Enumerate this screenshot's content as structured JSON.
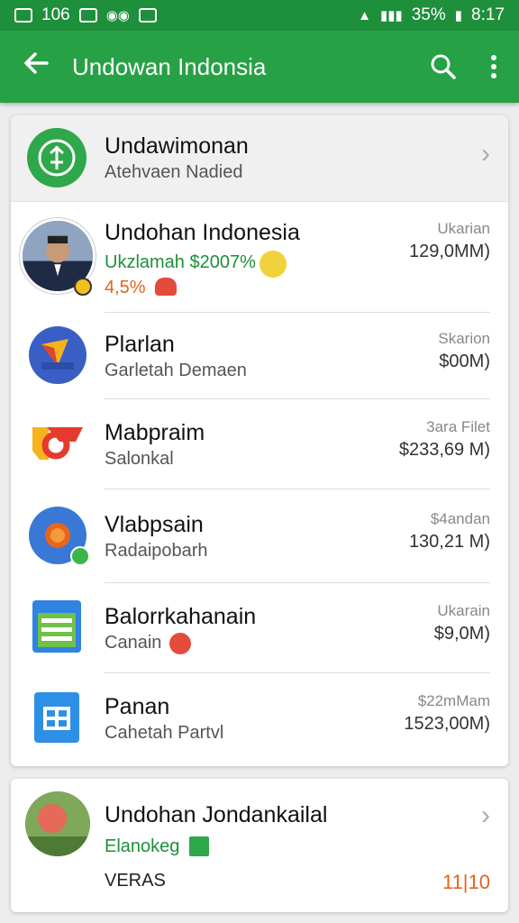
{
  "status_bar": {
    "left_text": "106",
    "battery": "35%",
    "time": "8:17"
  },
  "app_bar": {
    "title": "Undowan Indonsia"
  },
  "header": {
    "title": "Undawimonan",
    "subtitle": "Atehvaen Nadied"
  },
  "list": [
    {
      "name": "Undohan Indonesia",
      "sub": "Ukzlamah $2007%",
      "sub2": "4,5%",
      "right_top": "Ukarian",
      "right_value": "129,0MM)"
    },
    {
      "name": "Plarlan",
      "sub": "Garletah Demaen",
      "right_top": "Skarion",
      "right_value": "$00M)"
    },
    {
      "name": "Mabpraim",
      "sub": "Salonkal",
      "right_top": "3ara Filet",
      "right_value": "$233,69 M)"
    },
    {
      "name": "Vlabpsain",
      "sub": "Radaipobarh",
      "right_top": "$4andan",
      "right_value": "130,21 M)"
    },
    {
      "name": "Balorrkahanain",
      "sub": "Canain",
      "right_top": "Ukarain",
      "right_value": "$9,0M)"
    },
    {
      "name": "Panan",
      "sub": "Cahetah Partvl",
      "right_top": "$22mMam",
      "right_value": "1523,00M)"
    }
  ],
  "bottom_card": {
    "name": "Undohan Jondankailal",
    "sub": "Elanokeg",
    "label": "VERAS",
    "count": "11|10"
  }
}
